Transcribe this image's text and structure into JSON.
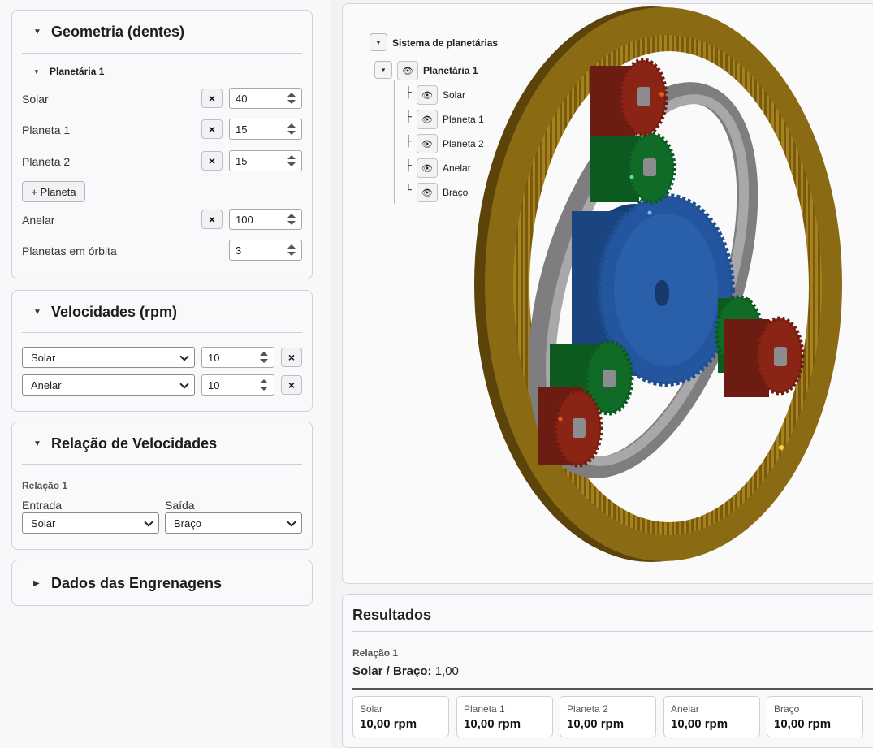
{
  "geometry": {
    "title": "Geometria (dentes)",
    "planetary_title": "Planetária 1",
    "rows": [
      {
        "label": "Solar",
        "value": "40"
      },
      {
        "label": "Planeta 1",
        "value": "15"
      },
      {
        "label": "Planeta 2",
        "value": "15"
      }
    ],
    "add_planet_label": "+ Planeta",
    "ring": {
      "label": "Anelar",
      "value": "100"
    },
    "orbit": {
      "label": "Planetas em órbita",
      "value": "3"
    },
    "remove_symbol": "×"
  },
  "speeds": {
    "title": "Velocidades (rpm)",
    "rows": [
      {
        "select": "Solar",
        "value": "10"
      },
      {
        "select": "Anelar",
        "value": "10"
      }
    ]
  },
  "ratio": {
    "title": "Relação de Velocidades",
    "subtitle": "Relação 1",
    "input_label": "Entrada",
    "output_label": "Saída",
    "input_value": "Solar",
    "output_value": "Braço"
  },
  "gear_data": {
    "title": "Dados das Engrenagens"
  },
  "tree": {
    "root": "Sistema de planetárias",
    "planetary": "Planetária 1",
    "children": [
      "Solar",
      "Planeta 1",
      "Planeta 2",
      "Anelar",
      "Braço"
    ]
  },
  "results": {
    "title": "Resultados",
    "relation_label": "Relação 1",
    "relation_text": "Solar / Braço:",
    "relation_value": "1,00",
    "items": [
      {
        "name": "Solar",
        "value": "10,00 rpm"
      },
      {
        "name": "Planeta 1",
        "value": "10,00 rpm"
      },
      {
        "name": "Planeta 2",
        "value": "10,00 rpm"
      },
      {
        "name": "Anelar",
        "value": "10,00 rpm"
      },
      {
        "name": "Braço",
        "value": "10,00 rpm"
      }
    ]
  },
  "colors": {
    "ring": "#8a6a12",
    "sun": "#1e4f91",
    "planet1": "#0f6b26",
    "planet2": "#8a2414",
    "carrier": "#9a9a9c"
  }
}
